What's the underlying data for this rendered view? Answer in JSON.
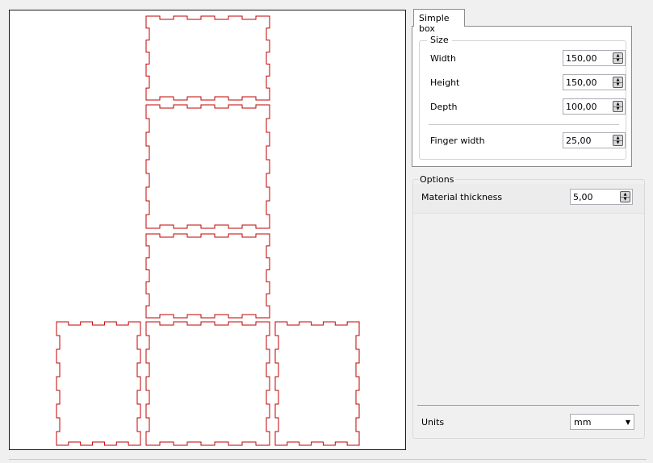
{
  "tabs": [
    {
      "label": "Simple box"
    }
  ],
  "size": {
    "title": "Size",
    "width": {
      "label": "Width",
      "value": "150,00"
    },
    "height": {
      "label": "Height",
      "value": "150,00"
    },
    "depth": {
      "label": "Depth",
      "value": "100,00"
    },
    "finger_width": {
      "label": "Finger width",
      "value": "25,00"
    }
  },
  "options": {
    "title": "Options",
    "material_thickness": {
      "label": "Material thickness",
      "value": "5,00"
    }
  },
  "units": {
    "label": "Units",
    "value": "mm"
  },
  "colors": {
    "cut_line": "#c00000",
    "canvas": "#ffffff"
  },
  "icons": {
    "spin": "spin-arrows-icon",
    "dropdown": "chevron-down-icon"
  }
}
